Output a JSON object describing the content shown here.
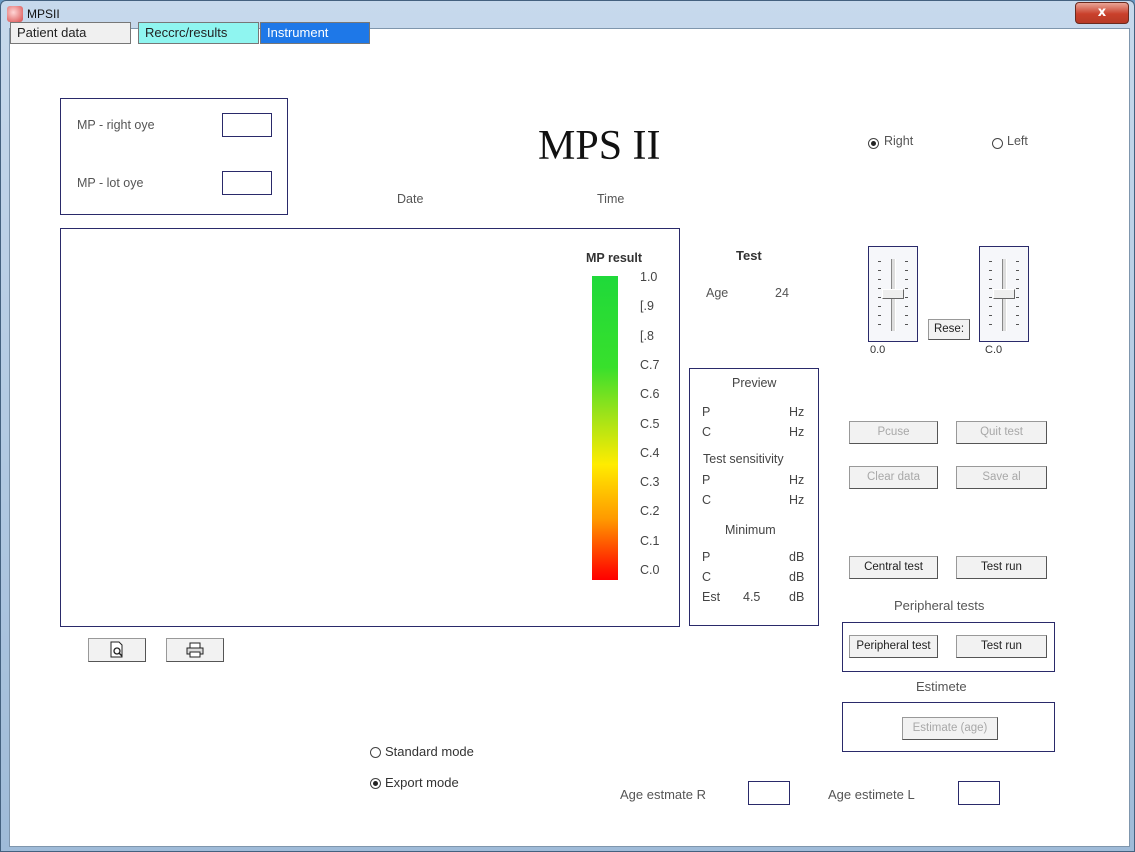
{
  "window": {
    "title": "MPSII",
    "close": "x"
  },
  "tabs": [
    "Patient data",
    "Reccrc/results",
    "Instrument"
  ],
  "mp_box": {
    "right_label": "MP - right oye",
    "left_label": "MP - lot oye"
  },
  "header": {
    "title": "MPS II",
    "date_label": "Date",
    "time_label": "Time"
  },
  "eye_select": {
    "right": "Right",
    "left": "Left",
    "selected": "Right"
  },
  "mp_result": {
    "label": "MP result",
    "ticks": [
      "1.0",
      "[.9",
      "[.8",
      "C.7",
      "C.6",
      "C.5",
      "C.4",
      "C.3",
      "C.2",
      "C.1",
      "C.0"
    ]
  },
  "test": {
    "heading": "Test",
    "age_label": "Age",
    "age_value": "24"
  },
  "sliders": {
    "left_value": "0.0",
    "right_value": "C.0",
    "reset_label": "Rese:"
  },
  "preview": {
    "heading": "Preview",
    "rows1": [
      {
        "k": "P",
        "u": "Hz"
      },
      {
        "k": "C",
        "u": "Hz"
      }
    ],
    "sens_heading": "Test sensitivity",
    "rows2": [
      {
        "k": "P",
        "u": "Hz"
      },
      {
        "k": "C",
        "u": "Hz"
      }
    ],
    "min_heading": "Minimum",
    "rows3": [
      {
        "k": "P",
        "v": "",
        "u": "dB"
      },
      {
        "k": "C",
        "v": "",
        "u": "dB"
      },
      {
        "k": "Est",
        "v": "4.5",
        "u": "dB"
      }
    ]
  },
  "buttons": {
    "pause": "Pcuse",
    "quit": "Quit test",
    "clear": "Clear data",
    "save": "Save al",
    "central": "Central test",
    "testrun1": "Test run",
    "peripheral": "Peripheral test",
    "testrun2": "Test run",
    "estimate": "Estimate (age)"
  },
  "peripheral_heading": "Peripheral tests",
  "estimate_heading": "Estimete",
  "mode": {
    "standard": "Standard mode",
    "expert": "Export mode",
    "selected": "expert"
  },
  "age_estimates": {
    "right_label": "Age estmate R",
    "left_label": "Age estimete L"
  },
  "colors": {
    "instrument_tab": "#1e78e8",
    "record_tab": "#8ff5f0",
    "frame_border": "#2a2a6a"
  }
}
